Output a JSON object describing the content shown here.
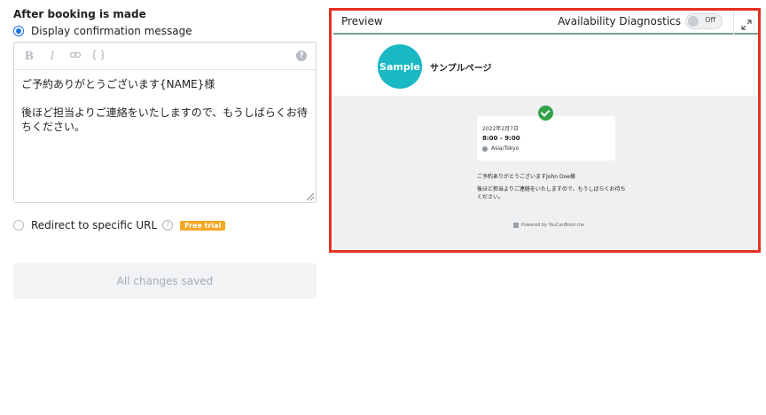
{
  "settings": {
    "section_title": "After booking is made",
    "display_confirmation_label": "Display confirmation message",
    "editor_toolbar": {
      "bold_label": "B",
      "italic_label": "I",
      "help_label": "?"
    },
    "editor_text": "ご予約ありがとうございます{NAME}様\n\n後ほど担当よりご連絡をいたしますので、もうしばらくお待ちください。",
    "redirect_label": "Redirect to specific URL",
    "help_label": "?",
    "free_trial_badge": "Free trial",
    "save_button_label": "All changes saved"
  },
  "preview": {
    "title": "Preview",
    "diagnostics_label": "Availability Diagnostics",
    "diagnostics_toggle_state": "Off",
    "logo_text": "Sample",
    "page_name": "サンプルページ",
    "booking_date": "2022年2月7日",
    "booking_time": "8:00 - 9:00",
    "timezone": "Asia/Tokyo",
    "confirmation_message": "ご予約ありがとうございますJohn Doe様",
    "follow_up_message": "後ほど担当よりご連絡をいたしますので、もうしばらくお待ちください。",
    "powered_by": "Powered by YouCanBook.me"
  },
  "colors": {
    "highlight_border": "#e53123",
    "radio_selected": "#1a73e8",
    "logo_bg": "#19b8c2",
    "check_green": "#34a14a",
    "badge_bg": "#f5a623"
  }
}
